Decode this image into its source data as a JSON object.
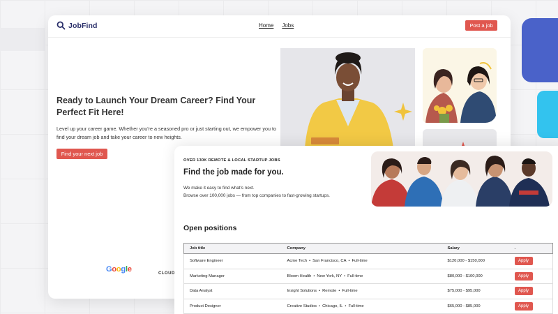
{
  "brand": {
    "name": "JobFind",
    "accent": "#e0574f",
    "navy": "#2a2f6a",
    "logo_icon": "search-icon"
  },
  "nav": {
    "home": "Home",
    "jobs": "Jobs"
  },
  "header": {
    "post_job": "Post a job"
  },
  "hero": {
    "title": "Ready to Launch Your Dream Career? Find Your Perfect Fit Here!",
    "description": "Level up your career game. Whether you're a seasoned pro or just starting out, we empower you to find your dream job and take your career to new heights.",
    "cta": "Find your next job"
  },
  "partners": {
    "google": "Google",
    "cloud": "CLOUD"
  },
  "section": {
    "eyebrow": "OVER 130K REMOTE & LOCAL STARTUP JOBS",
    "title": "Find the job made for you.",
    "desc_line1": "We make it easy to find what's next.",
    "desc_line2": "Browse over 100,000 jobs — from top companies to fast-growing startups."
  },
  "open_positions": {
    "title": "Open positions",
    "headers": {
      "job_title": "Job title",
      "company": "Company",
      "salary": "Salary",
      "action": "."
    },
    "apply_label": "Apply",
    "rows": [
      {
        "title": "Software Engineer",
        "company": "Acme Tech",
        "location": "San Francisco, CA",
        "type": "Full-time",
        "salary": "$120,000 - $150,000"
      },
      {
        "title": "Marketing Manager",
        "company": "Bloom Health",
        "location": "New York, NY",
        "type": "Full-time",
        "salary": "$80,000 - $100,000"
      },
      {
        "title": "Data Analyst",
        "company": "Insight Solutions",
        "location": "Remote",
        "type": "Full-time",
        "salary": "$75,000 - $95,000"
      },
      {
        "title": "Product Designer",
        "company": "Creative Studios",
        "location": "Chicago, IL",
        "type": "Full-time",
        "salary": "$65,000 - $85,000"
      }
    ]
  }
}
